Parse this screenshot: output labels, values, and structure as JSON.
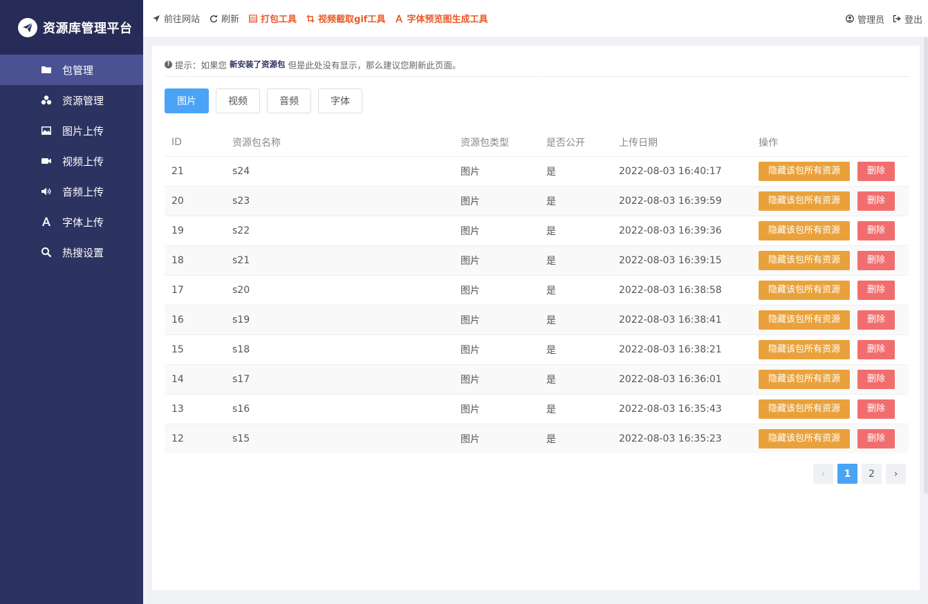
{
  "sidebar": {
    "title": "资源库管理平台",
    "items": [
      {
        "label": "包管理",
        "icon": "folder-icon"
      },
      {
        "label": "资源管理",
        "icon": "cubes-icon"
      },
      {
        "label": "图片上传",
        "icon": "image-icon"
      },
      {
        "label": "视频上传",
        "icon": "video-icon"
      },
      {
        "label": "音频上传",
        "icon": "volume-icon"
      },
      {
        "label": "字体上传",
        "icon": "font-icon"
      },
      {
        "label": "热搜设置",
        "icon": "search-icon"
      }
    ]
  },
  "topbar": {
    "goto_site": "前往网站",
    "refresh": "刷新",
    "pack_tool": "打包工具",
    "gif_tool": "视频截取gif工具",
    "font_tool": "字体预览图生成工具",
    "admin": "管理员",
    "logout": "登出"
  },
  "tip": {
    "prefix": "提示：如果您",
    "strong": "新安装了资源包",
    "suffix": "但是此处没有显示，那么建议您刷新此页面。"
  },
  "tabs": [
    "图片",
    "视频",
    "音频",
    "字体"
  ],
  "table": {
    "headers": [
      "ID",
      "资源包名称",
      "资源包类型",
      "是否公开",
      "上传日期",
      "操作"
    ],
    "rows": [
      [
        "21",
        "s24",
        "图片",
        "是",
        "2022-08-03 16:40:17"
      ],
      [
        "20",
        "s23",
        "图片",
        "是",
        "2022-08-03 16:39:59"
      ],
      [
        "19",
        "s22",
        "图片",
        "是",
        "2022-08-03 16:39:36"
      ],
      [
        "18",
        "s21",
        "图片",
        "是",
        "2022-08-03 16:39:15"
      ],
      [
        "17",
        "s20",
        "图片",
        "是",
        "2022-08-03 16:38:58"
      ],
      [
        "16",
        "s19",
        "图片",
        "是",
        "2022-08-03 16:38:41"
      ],
      [
        "15",
        "s18",
        "图片",
        "是",
        "2022-08-03 16:38:21"
      ],
      [
        "14",
        "s17",
        "图片",
        "是",
        "2022-08-03 16:36:01"
      ],
      [
        "13",
        "s16",
        "图片",
        "是",
        "2022-08-03 16:35:43"
      ],
      [
        "12",
        "s15",
        "图片",
        "是",
        "2022-08-03 16:35:23"
      ]
    ],
    "hide_label": "隐藏该包所有资源",
    "delete_label": "删除"
  },
  "pagination": {
    "prev": "‹",
    "pages": [
      "1",
      "2"
    ],
    "next": "›"
  },
  "colors": {
    "sidebar": "#2d3360",
    "sidebar_active": "#4a5293",
    "primary": "#4aa3f5",
    "warning": "#e9a23b",
    "danger": "#f26d6d",
    "tool_text": "#e85a27"
  }
}
